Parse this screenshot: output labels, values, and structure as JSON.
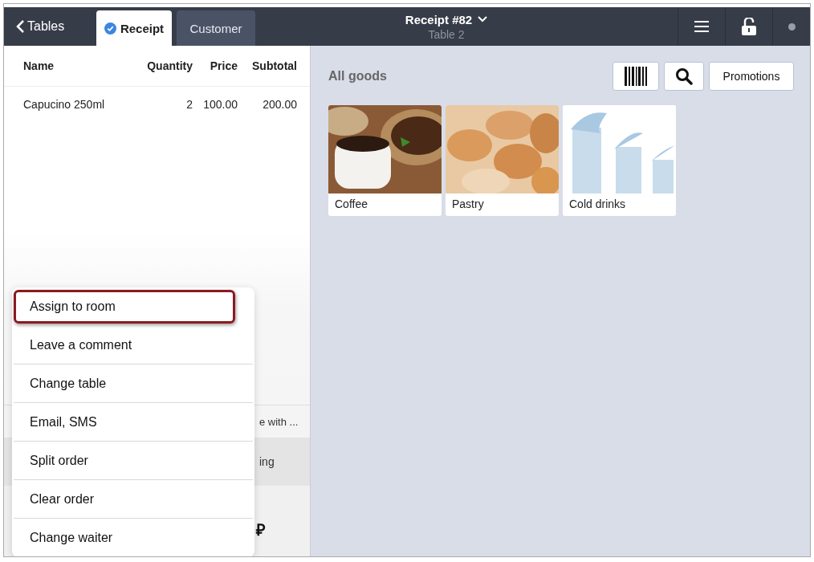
{
  "topbar": {
    "back": "Tables",
    "tabs": [
      {
        "label": "Receipt",
        "selected": true
      },
      {
        "label": "Customer",
        "selected": false
      }
    ],
    "title": "Receipt #82",
    "subtitle": "Table 2"
  },
  "order": {
    "columns": [
      "Name",
      "Quantity",
      "Price",
      "Subtotal"
    ],
    "rows": [
      [
        "Capucino 250ml",
        "2",
        "100.00",
        "200.00"
      ]
    ],
    "comment": "e with ...",
    "warning": "ing",
    "totals": {
      "currency": "₽"
    }
  },
  "menu": [
    {
      "label": "Assign to room",
      "highlighted": true
    },
    {
      "label": "Leave a comment",
      "highlighted": false
    },
    {
      "label": "Change table",
      "highlighted": false
    },
    {
      "label": "Email, SMS",
      "highlighted": false
    },
    {
      "label": "Split order",
      "highlighted": false
    },
    {
      "label": "Clear order",
      "highlighted": false
    },
    {
      "label": "Change waiter",
      "highlighted": false
    }
  ],
  "goods": {
    "title": "All goods",
    "promotions": "Promotions",
    "categories": [
      {
        "label": "Coffee",
        "kind": "coffee"
      },
      {
        "label": "Pastry",
        "kind": "pastry"
      },
      {
        "label": "Cold drinks",
        "kind": "drinks"
      }
    ]
  }
}
